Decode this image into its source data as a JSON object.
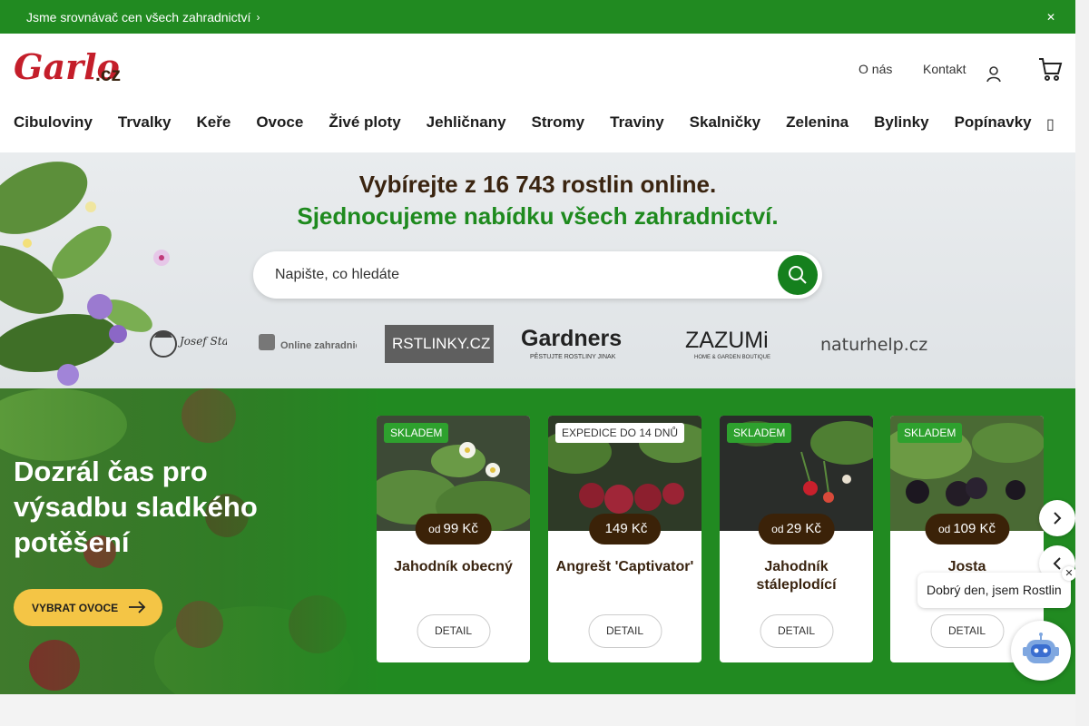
{
  "topbar": {
    "text": "Jsme srovnávač cen všech zahradnictví"
  },
  "header": {
    "logo_text": "Garlo",
    "logo_suffix": ".cz",
    "links": [
      "O nás",
      "Kontakt"
    ]
  },
  "nav": {
    "items": [
      "Cibuloviny",
      "Trvalky",
      "Keře",
      "Ovoce",
      "Živé ploty",
      "Jehličnany",
      "Stromy",
      "Traviny",
      "Skalničky",
      "Zelenina",
      "Bylinky",
      "Popínavky"
    ]
  },
  "hero": {
    "title": "Vybírejte z 16 743 rostlin online.",
    "subtitle": "Sjednocujeme nabídku všech zahradnictví.",
    "search_placeholder": "Napište, co hledáte"
  },
  "partners": [
    {
      "name": "Josef Starkl"
    },
    {
      "name": "Online zahradnictví"
    },
    {
      "name": "RSTLINKY.CZ"
    },
    {
      "name": "Gardners",
      "tagline": "PĚSTUJTE ROSTLINY JINAK"
    },
    {
      "name": "ZAZUMi",
      "tagline": "HOME & GARDEN BOUTIQUE"
    },
    {
      "name": "naturhelp.cz"
    }
  ],
  "promo": {
    "title": "Dozrál čas pro výsadbu sladkého potěšení",
    "button": "VYBRAT OVOCE"
  },
  "products": [
    {
      "badge": "SKLADEM",
      "badge_style": "green",
      "price_prefix": "od",
      "price": "99 Kč",
      "name": "Jahodník obecný",
      "detail": "DETAIL"
    },
    {
      "badge": "EXPEDICE DO 14 DNŮ",
      "badge_style": "white",
      "price_prefix": "",
      "price": "149 Kč",
      "name": "Angrešt 'Captivator'",
      "detail": "DETAIL"
    },
    {
      "badge": "SKLADEM",
      "badge_style": "green",
      "price_prefix": "od",
      "price": "29 Kč",
      "name": "Jahodník stáleplodící",
      "detail": "DETAIL"
    },
    {
      "badge": "SKLADEM",
      "badge_style": "green",
      "price_prefix": "od",
      "price": "109 Kč",
      "name": "Josta",
      "detail": "DETAIL"
    }
  ],
  "chat": {
    "greeting": "Dobrý den, jsem Rostlin"
  },
  "colors": {
    "brand_green": "#218a21",
    "brand_red": "#c41e2a",
    "price_brown": "#3b2208",
    "button_yellow": "#f4c545"
  }
}
